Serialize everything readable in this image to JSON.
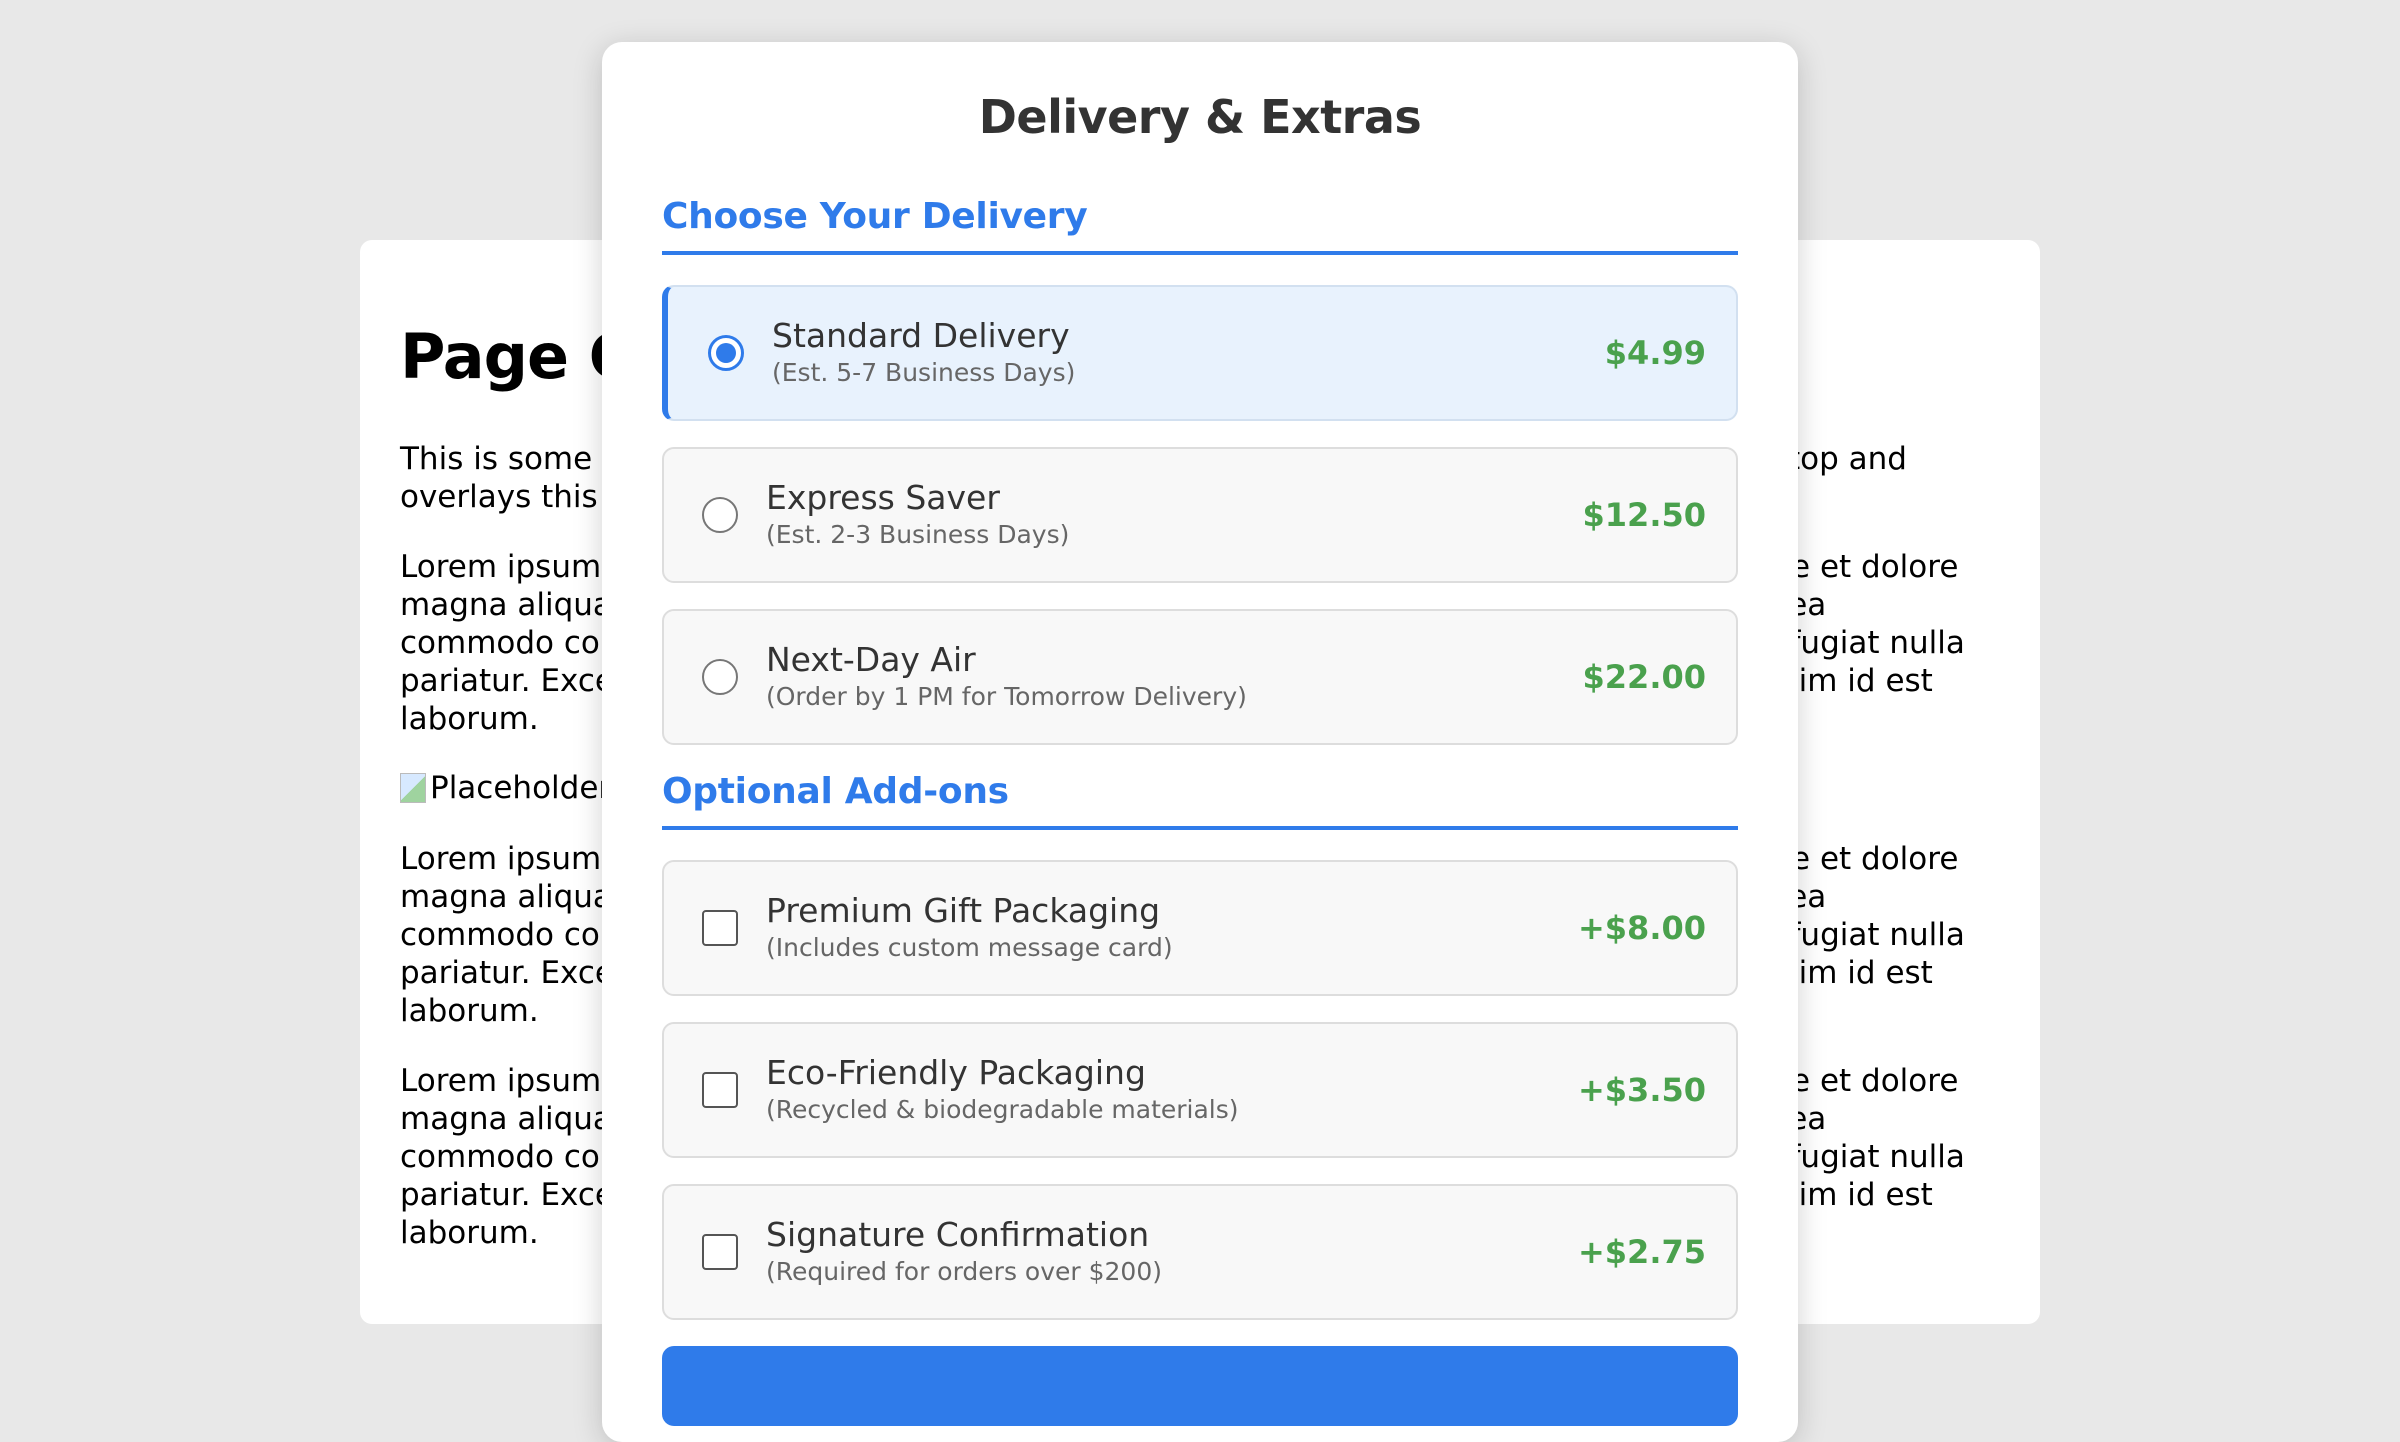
{
  "background_page": {
    "title": "Page C",
    "paragraph1_left": "This is some e\noverlays this c",
    "paragraph1_right": "top and",
    "lorem_left": "Lorem ipsum c\nmagna aliqua.\ncommodo cor\npariatur. Excep\nlaborum.",
    "lorem_right": "ore et dolore\nx ea\nu fugiat nulla\nanim id est",
    "image_alt": "Placeholder"
  },
  "modal": {
    "title": "Delivery & Extras",
    "delivery_heading": "Choose Your Delivery",
    "delivery_options": [
      {
        "name": "Standard Delivery",
        "sub": "(Est. 5-7 Business Days)",
        "price": "$4.99",
        "selected": true
      },
      {
        "name": "Express Saver",
        "sub": "(Est. 2-3 Business Days)",
        "price": "$12.50",
        "selected": false
      },
      {
        "name": "Next-Day Air",
        "sub": "(Order by 1 PM for Tomorrow Delivery)",
        "price": "$22.00",
        "selected": false
      }
    ],
    "addons_heading": "Optional Add-ons",
    "addons": [
      {
        "name": "Premium Gift Packaging",
        "sub": "(Includes custom message card)",
        "price": "+$8.00",
        "checked": false
      },
      {
        "name": "Eco-Friendly Packaging",
        "sub": "(Recycled & biodegradable materials)",
        "price": "+$3.50",
        "checked": false
      },
      {
        "name": "Signature Confirmation",
        "sub": "(Required for orders over $200)",
        "price": "+$2.75",
        "checked": false
      }
    ]
  },
  "colors": {
    "accent": "#2f7bea",
    "price": "#4aa14d",
    "backdrop": "#e8e8e8"
  }
}
